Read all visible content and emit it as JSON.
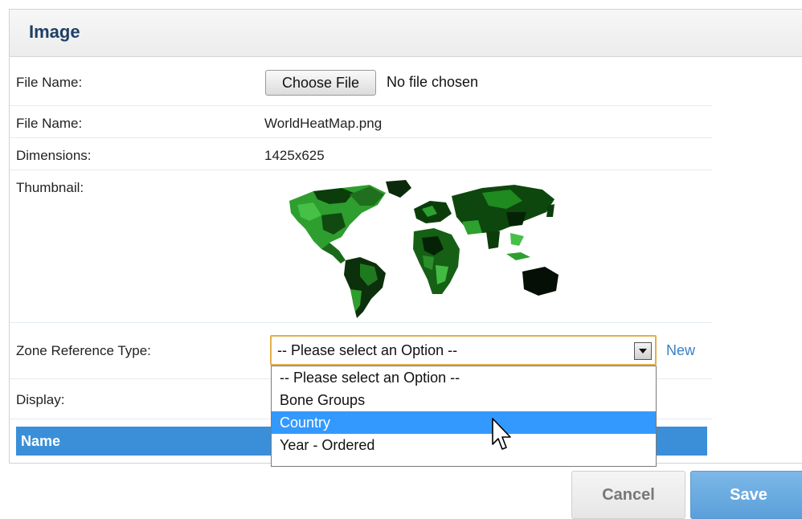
{
  "panel": {
    "title": "Image"
  },
  "fields": {
    "file_input_label": "File Name:",
    "choose_file_button": "Choose File",
    "no_file_text": "No file chosen",
    "file_name_label": "File Name:",
    "file_name_value": "WorldHeatMap.png",
    "dimensions_label": "Dimensions:",
    "dimensions_value": "1425x625",
    "thumbnail_label": "Thumbnail:",
    "zone_ref_label": "Zone Reference Type:",
    "zone_ref_selected": "-- Please select an Option --",
    "new_link": "New",
    "display_label": "Display:"
  },
  "dropdown": {
    "options": [
      "-- Please select an Option --",
      "Bone Groups",
      "Country",
      "Year - Ordered"
    ],
    "highlighted_index": 2
  },
  "table": {
    "header_name": "Name"
  },
  "buttons": {
    "cancel": "Cancel",
    "save": "Save"
  },
  "colors": {
    "header_title": "#1f3f66",
    "table_header": "#3a8fd8",
    "option_highlight": "#3399ff",
    "link": "#3a7fc4",
    "select_focus_border": "#e2b04a"
  },
  "icons": {
    "select_arrow": "chevron-down-icon",
    "cursor": "mouse-pointer-icon",
    "thumbnail": "world-heat-map-image"
  }
}
